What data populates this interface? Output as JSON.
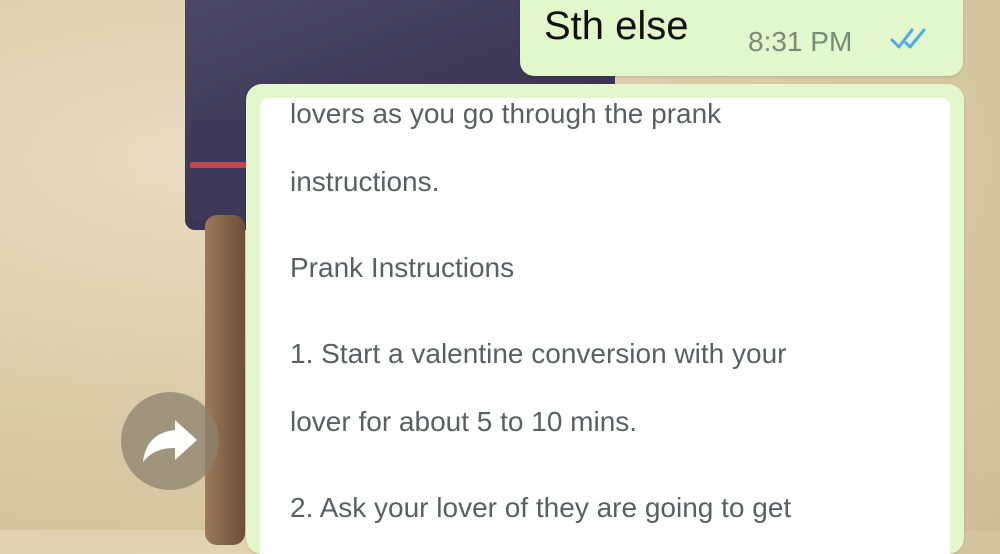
{
  "chat": {
    "outgoing": {
      "text": "Sth else",
      "time": "8:31 PM",
      "status_icon": "double-check-icon",
      "status_color": "#4fa8e8"
    },
    "forwarded_message": {
      "lines": [
        "lovers as you go through the prank",
        "instructions.",
        "Prank Instructions",
        "1. Start a valentine conversion with your",
        "lover for about 5 to 10 mins.",
        "2. Ask your lover of they are going to get"
      ]
    },
    "forward_button": {
      "icon": "forward-arrow-icon"
    }
  },
  "colors": {
    "bubble": "#e2f7cb",
    "card_text": "#5b5f63",
    "wallpaper": "#dccda9"
  }
}
